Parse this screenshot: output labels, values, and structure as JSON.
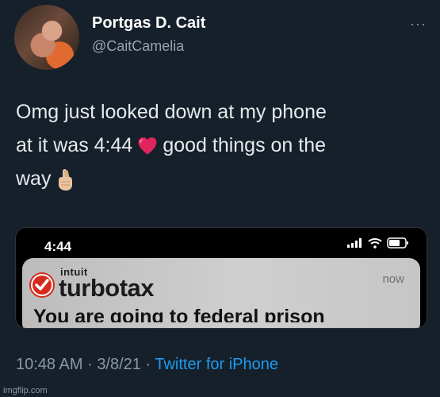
{
  "user": {
    "display_name": "Portgas D. Cait",
    "handle": "@CaitCamelia",
    "avatar_icon": "profile-photo"
  },
  "more_label": "···",
  "tweet": {
    "line1": "Omg just looked down at my phone",
    "line2_a": "at it was 4:44",
    "line2_b": "good things on the",
    "line3": "way",
    "emojis": [
      "red-heart-emoji",
      "crossed-fingers-emoji"
    ]
  },
  "media": {
    "status_time": "4:44",
    "status_icons": [
      "signal-icon",
      "wifi-icon",
      "battery-icon"
    ],
    "notification": {
      "brand_prefix": "intuit",
      "brand": "turbotax",
      "time": "now",
      "message": "You are going to federal prison"
    }
  },
  "footer": {
    "time": "10:48 AM",
    "date": "3/8/21",
    "separator": "·",
    "source": "Twitter for iPhone"
  },
  "watermark": "imgflip.com",
  "colors": {
    "background": "#15202b",
    "link": "#1d9bf0",
    "turbotax_red": "#d52b1e"
  }
}
